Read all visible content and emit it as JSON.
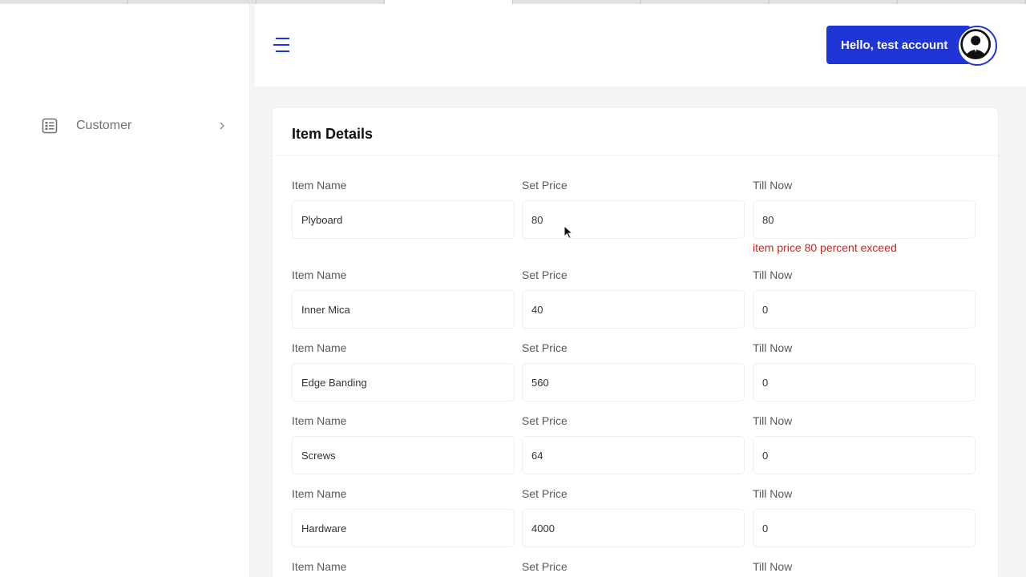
{
  "sidebar": {
    "items": [
      {
        "label": "Customer",
        "icon": "list-icon"
      }
    ]
  },
  "header": {
    "menu_icon": "hamburger-icon",
    "user_button_label": "Hello, test account",
    "avatar_icon": "user-avatar-icon",
    "accent_color": "#1f35d6"
  },
  "card": {
    "title": "Item Details",
    "columns": [
      "Item Name",
      "Set Price",
      "Till Now"
    ],
    "rows": [
      {
        "item_name": "Plyboard",
        "set_price": "80",
        "till_now": "80",
        "error": "item price 80 percent exceed"
      },
      {
        "item_name": "Inner Mica",
        "set_price": "40",
        "till_now": "0"
      },
      {
        "item_name": "Edge Banding",
        "set_price": "560",
        "till_now": "0"
      },
      {
        "item_name": "Screws",
        "set_price": "64",
        "till_now": "0"
      },
      {
        "item_name": "Hardware",
        "set_price": "4000",
        "till_now": "0"
      }
    ],
    "error_color": "#d0211c"
  }
}
